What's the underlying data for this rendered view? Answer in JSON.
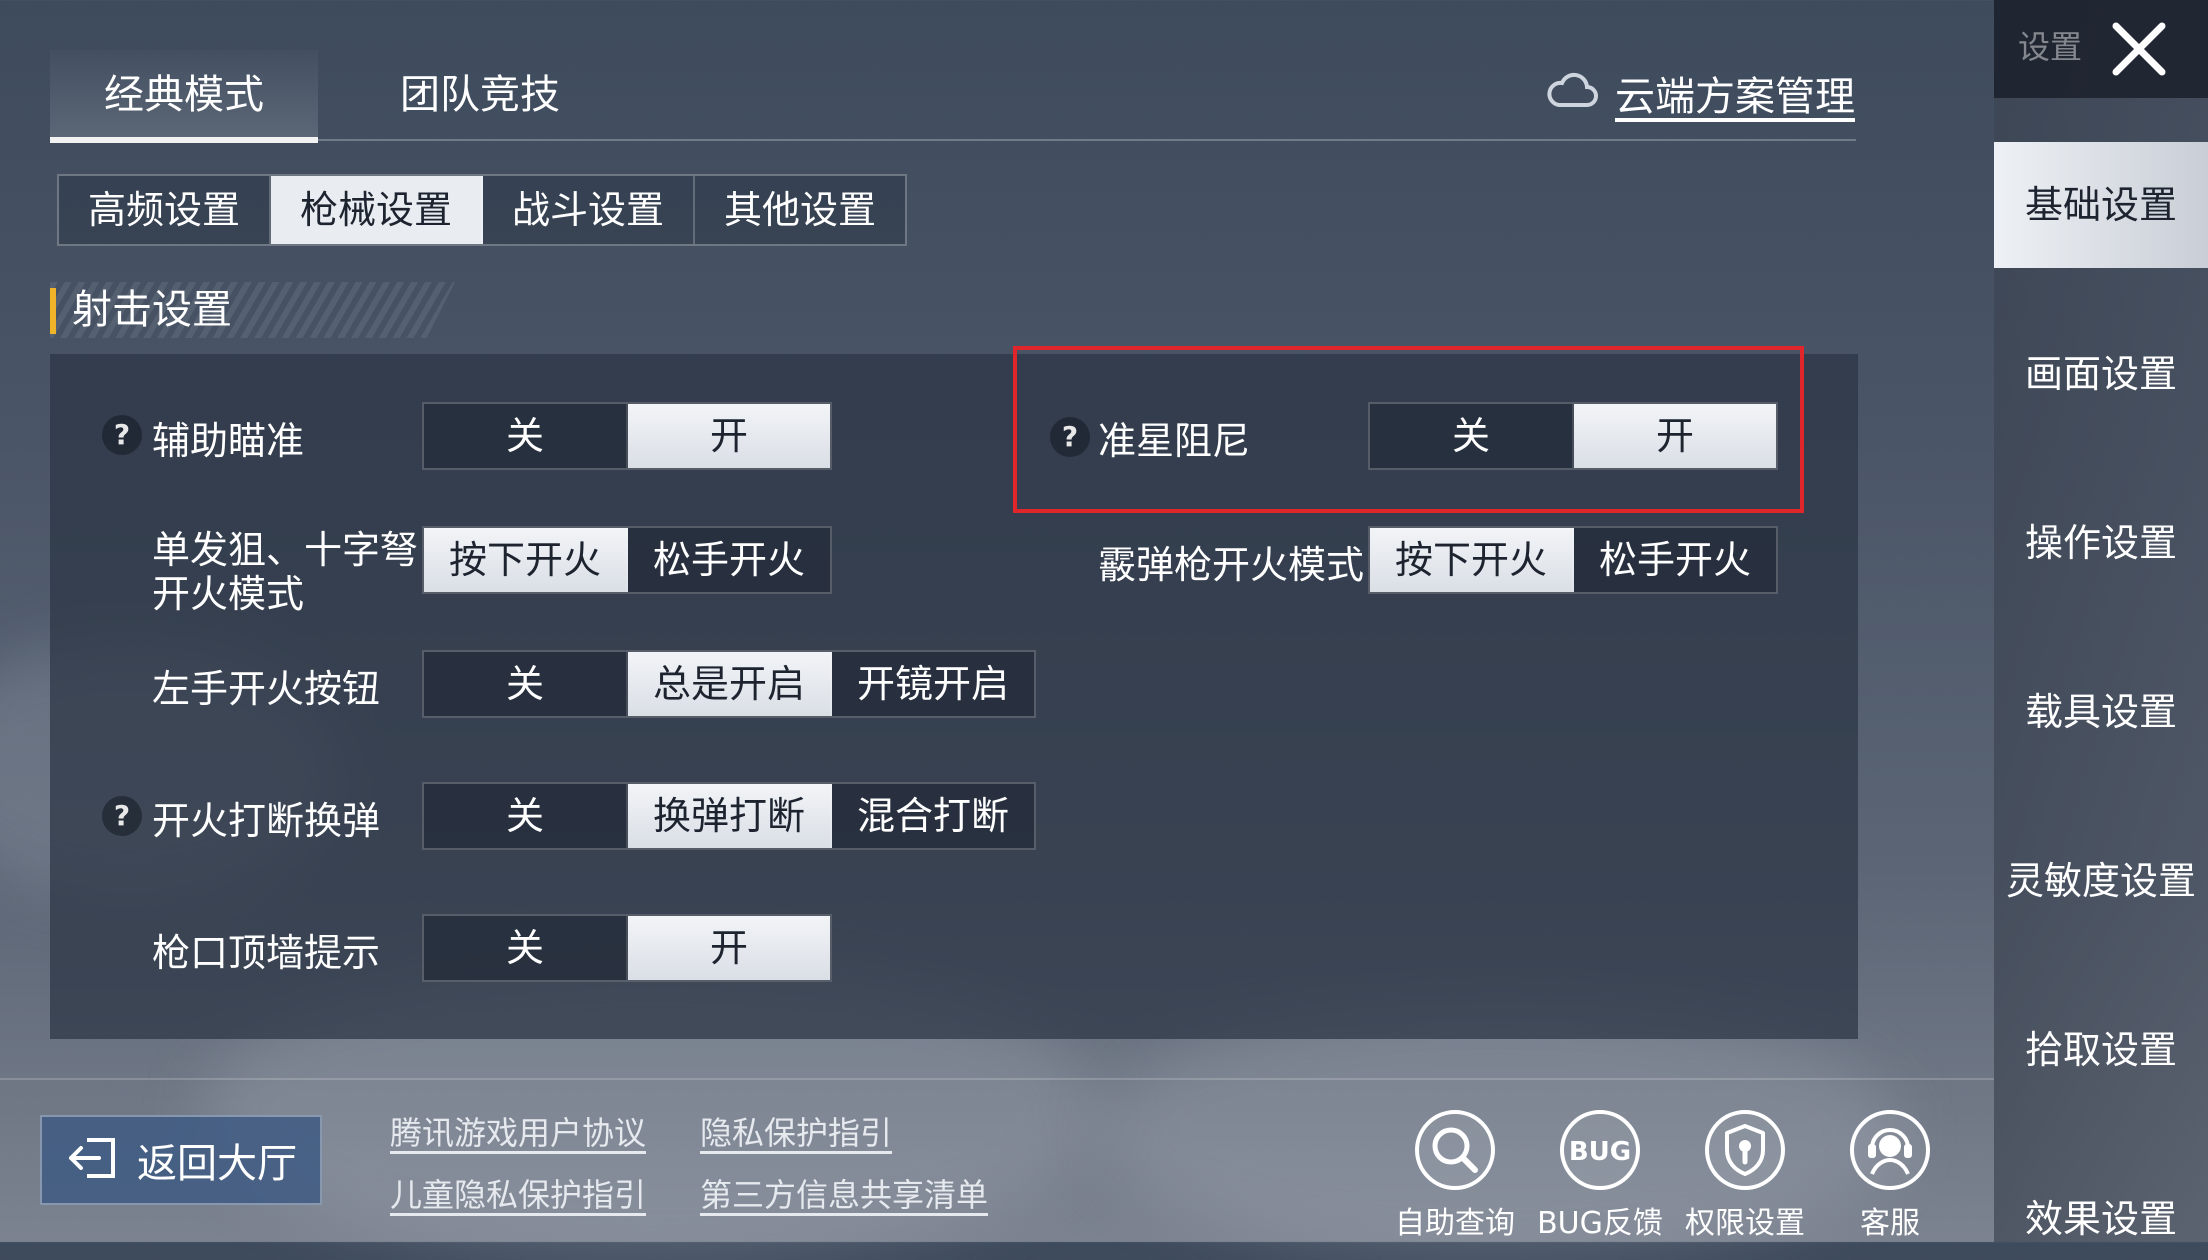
{
  "top_tabs": {
    "classic": "经典模式",
    "team": "团队竞技"
  },
  "cloud_manage": "云端方案管理",
  "sub_tabs": [
    "高频设置",
    "枪械设置",
    "战斗设置",
    "其他设置"
  ],
  "sub_tab_active": "枪械设置",
  "section_title": "射击设置",
  "settings": {
    "aim_assist": {
      "label": "辅助瞄准",
      "options": [
        "关",
        "开"
      ],
      "selected": "开"
    },
    "crosshair_damping": {
      "label": "准星阻尼",
      "options": [
        "关",
        "开"
      ],
      "selected": "开"
    },
    "sniper_fire_mode": {
      "label_line1": "单发狙、十字弩",
      "label_line2": "开火模式",
      "options": [
        "按下开火",
        "松手开火"
      ],
      "selected": "按下开火"
    },
    "shotgun_fire_mode": {
      "label": "霰弹枪开火模式",
      "options": [
        "按下开火",
        "松手开火"
      ],
      "selected": "按下开火"
    },
    "left_fire_button": {
      "label": "左手开火按钮",
      "options": [
        "关",
        "总是开启",
        "开镜开启"
      ],
      "selected": "总是开启"
    },
    "fire_interrupt_reload": {
      "label": "开火打断换弹",
      "options": [
        "关",
        "换弹打断",
        "混合打断"
      ],
      "selected": "换弹打断"
    },
    "muzzle_wall_hint": {
      "label": "枪口顶墙提示",
      "options": [
        "关",
        "开"
      ],
      "selected": "开"
    }
  },
  "sidebar": {
    "title": "设置",
    "items": [
      "基础设置",
      "画面设置",
      "操作设置",
      "载具设置",
      "灵敏度设置",
      "拾取设置",
      "效果设置"
    ],
    "active": "基础设置"
  },
  "bottom": {
    "back_label": "返回大厅",
    "links": [
      "腾讯游戏用户协议",
      "隐私保护指引",
      "儿童隐私保护指引",
      "第三方信息共享清单"
    ],
    "tools": [
      {
        "label": "自助查询",
        "icon": "search-icon"
      },
      {
        "label": "BUG反馈",
        "icon": "bug-icon"
      },
      {
        "label": "权限设置",
        "icon": "shield-icon"
      },
      {
        "label": "客服",
        "icon": "headset-icon"
      }
    ],
    "bug_icon_text": "BUG"
  },
  "colors": {
    "highlight": "#e0262b",
    "section_accent": "#f0b429",
    "selected_option": "#e9edf2"
  }
}
